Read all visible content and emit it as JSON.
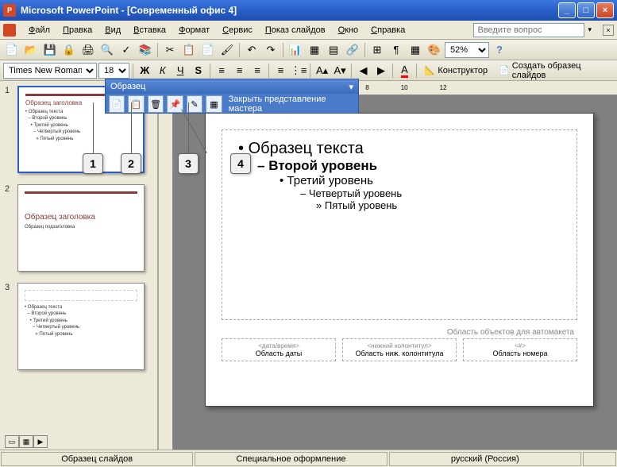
{
  "titlebar": {
    "app": "Microsoft PowerPoint",
    "doc": "[Современный офис 4]"
  },
  "menu": {
    "file": "Файл",
    "edit": "Правка",
    "view": "Вид",
    "insert": "Вставка",
    "format": "Формат",
    "tools": "Сервис",
    "slideshow": "Показ слайдов",
    "window": "Окно",
    "help": "Справка"
  },
  "ask_placeholder": "Введите вопрос",
  "zoom": "52%",
  "font": {
    "name": "Times New Roman",
    "size": "18"
  },
  "designer_label": "Конструктор",
  "create_master_label": "Создать образец слайдов",
  "sample_toolbar": {
    "title": "Образец",
    "close_master": "Закрыть представление мастера"
  },
  "callouts": {
    "c1": "1",
    "c2": "2",
    "c3": "3",
    "c4": "4"
  },
  "thumbs": {
    "t1": {
      "title": "Образец заголовка",
      "sub": "Образец текста",
      "l2": "Второй уровень",
      "l3": "Третий уровень",
      "l4": "Четвертый уровень",
      "l5": "Пятый уровень"
    },
    "t2": {
      "title": "Образец заголовка",
      "sub": "Образец подзаголовка"
    },
    "t3": {
      "sub": "Образец текста",
      "l2": "Второй уровень",
      "l3": "Третий уровень",
      "l4": "Четвертый уровень",
      "l5": "Пятый уровень"
    }
  },
  "slide": {
    "lvl1": "Образец текста",
    "lvl2": "Второй уровень",
    "lvl3": "Третий уровень",
    "lvl4": "Четвертый уровень",
    "lvl5": "Пятый уровень",
    "automaket": "Область объектов для автомакета",
    "footer1_ph": "<дата/время>",
    "footer1": "Область даты",
    "footer2_ph": "<нижний колонтитул>",
    "footer2": "Область ниж. колонтитула",
    "footer3_ph": "<#>",
    "footer3": "Область номера"
  },
  "status": {
    "s1": "Образец слайдов",
    "s2": "Специальное оформление",
    "s3": "русский (Россия)"
  }
}
